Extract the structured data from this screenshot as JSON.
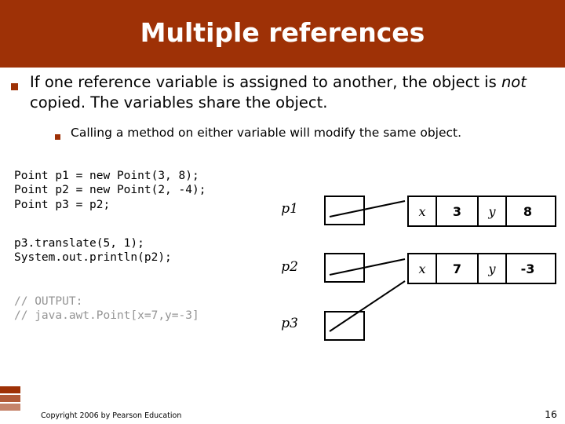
{
  "slide": {
    "title": "Multiple references",
    "page_number": "16",
    "copyright": "Copyright 2006 by Pearson Education",
    "accent_color": "#9e3106",
    "comment_color": "#949494",
    "bullets": [
      {
        "level": 1,
        "text_before_italic": "If one reference variable is assigned to another, the object is ",
        "italic_word": "not",
        "text_after_italic": " copied.  The variables share the object."
      },
      {
        "level": 2,
        "text": "Calling a method on either variable will modify the same object."
      }
    ],
    "code_blocks": [
      {
        "name": "declaration-code",
        "lines": [
          "Point p1 = new Point(3, 8);",
          "Point p2 = new Point(2, -4);",
          "Point p3 = p2;"
        ]
      },
      {
        "name": "translate-code",
        "lines": [
          "p3.translate(5, 1);",
          "System.out.println(p2);"
        ]
      },
      {
        "name": "output-comment-code",
        "lines": [
          "// OUTPUT:",
          "// java.awt.Point[x=7,y=-3]"
        ]
      }
    ],
    "diagram": {
      "references": [
        {
          "label": "p1"
        },
        {
          "label": "p2"
        },
        {
          "label": "p3"
        }
      ],
      "objects": [
        {
          "name": "point-object-1",
          "fields": [
            {
              "name": "x",
              "value": "3"
            },
            {
              "name": "y",
              "value": "8"
            }
          ]
        },
        {
          "name": "point-object-2",
          "fields": [
            {
              "name": "x",
              "value": "7"
            },
            {
              "name": "y",
              "value": "-3"
            }
          ]
        }
      ]
    }
  }
}
